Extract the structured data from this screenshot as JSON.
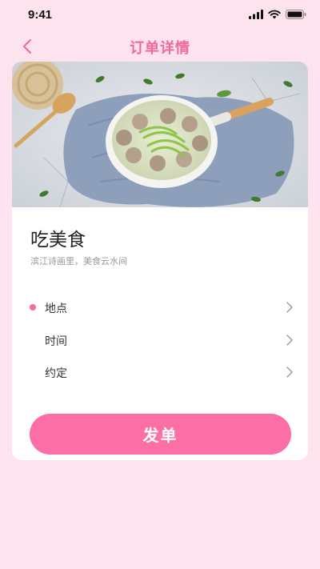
{
  "status_bar": {
    "time": "9:41"
  },
  "header": {
    "title": "订单详情"
  },
  "product": {
    "title": "吃美食",
    "subtitle": "滨江诗画里，美食云水间"
  },
  "menu": {
    "items": [
      {
        "label": "地点"
      },
      {
        "label": "时间"
      },
      {
        "label": "约定"
      }
    ]
  },
  "actions": {
    "submit_label": "发单"
  },
  "colors": {
    "accent": "#f06aa2",
    "background": "#fde3ee",
    "button": "#fb6fa4"
  }
}
